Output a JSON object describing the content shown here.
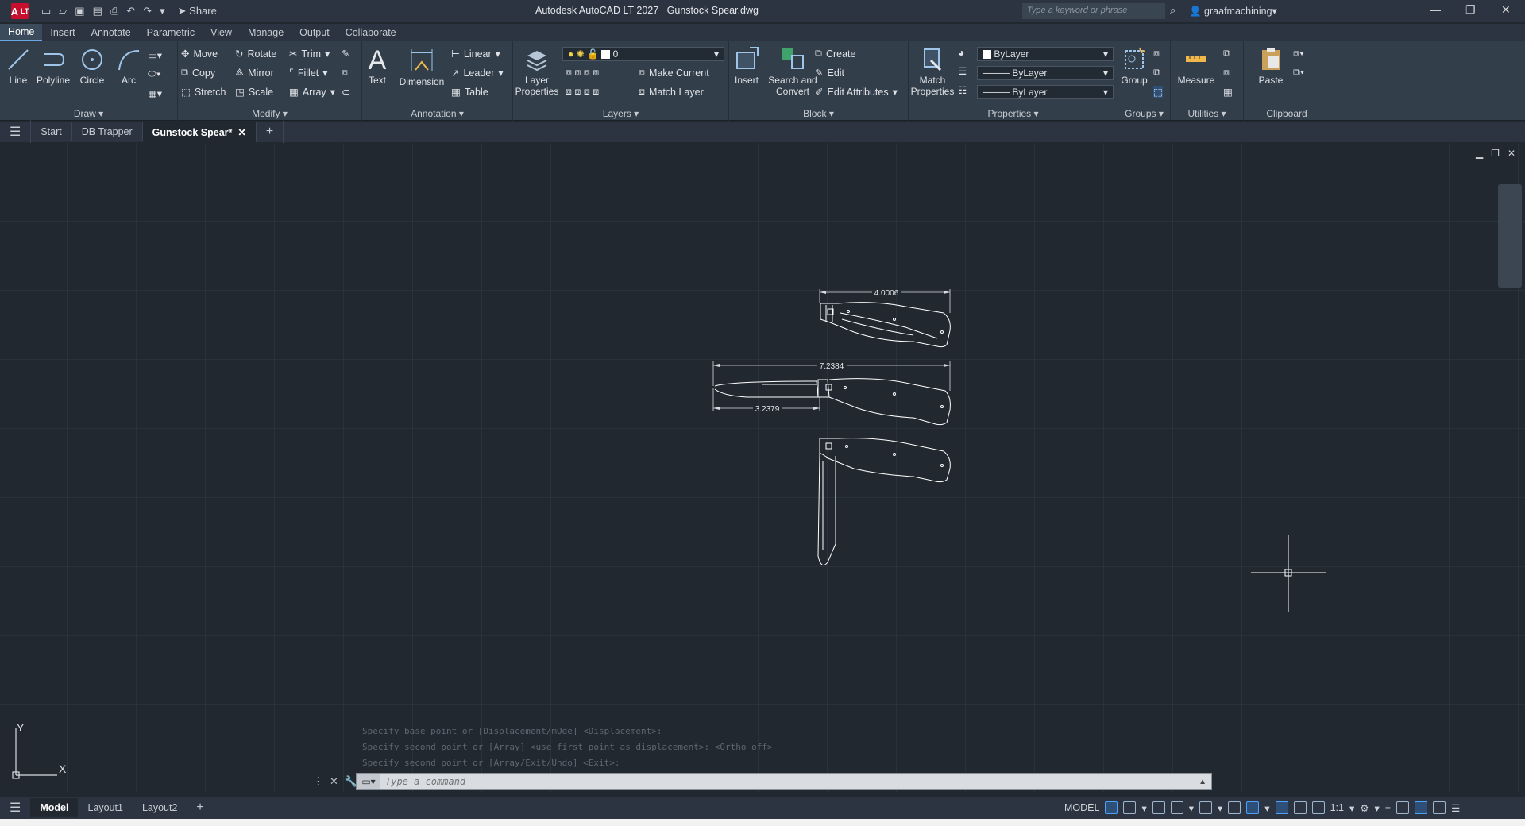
{
  "app": {
    "title": "Autodesk AutoCAD LT 2027",
    "document": "Gunstock Spear.dwg",
    "logo": "A",
    "edition": "LT",
    "share_label": "Share",
    "search_placeholder": "Type a keyword or phrase",
    "user": "graafmachining"
  },
  "menu": [
    "Home",
    "Insert",
    "Annotate",
    "Parametric",
    "View",
    "Manage",
    "Output",
    "Collaborate"
  ],
  "ribbon": {
    "draw": {
      "title": "Draw",
      "line": "Line",
      "polyline": "Polyline",
      "circle": "Circle",
      "arc": "Arc"
    },
    "modify": {
      "title": "Modify",
      "move": "Move",
      "rotate": "Rotate",
      "trim": "Trim",
      "copy": "Copy",
      "mirror": "Mirror",
      "fillet": "Fillet",
      "stretch": "Stretch",
      "scale": "Scale",
      "array": "Array"
    },
    "annotation": {
      "title": "Annotation",
      "text": "Text",
      "dimension": "Dimension",
      "linear": "Linear",
      "leader": "Leader",
      "table": "Table"
    },
    "layers": {
      "title": "Layers",
      "layer_properties_1": "Layer",
      "layer_properties_2": "Properties",
      "current_layer": "0",
      "make_current": "Make Current",
      "match_layer": "Match Layer"
    },
    "block": {
      "title": "Block",
      "insert": "Insert",
      "search_convert_1": "Search and",
      "search_convert_2": "Convert",
      "create": "Create",
      "edit": "Edit",
      "edit_attributes": "Edit Attributes"
    },
    "properties": {
      "title": "Properties",
      "match_1": "Match",
      "match_2": "Properties",
      "color": "ByLayer",
      "linetype": "ByLayer",
      "lineweight": "ByLayer"
    },
    "groups": {
      "title": "Groups",
      "group": "Group"
    },
    "utilities": {
      "title": "Utilities",
      "measure": "Measure"
    },
    "clipboard": {
      "title": "Clipboard",
      "paste": "Paste"
    }
  },
  "doc_tabs": [
    "Start",
    "DB Trapper",
    "Gunstock Spear*"
  ],
  "drawing": {
    "dim_top": "4.0006",
    "dim_overall": "7.2384",
    "dim_blade": "3.2379"
  },
  "command": {
    "history": [
      "Specify base point or [Displacement/mOde] <Displacement>:",
      "Specify second point or [Array] <use first point as displacement>:  <Ortho off>",
      "Specify second point or [Array/Exit/Undo] <Exit>:"
    ],
    "placeholder": "Type a command"
  },
  "layouts": [
    "Model",
    "Layout1",
    "Layout2"
  ],
  "status": {
    "mode": "MODEL",
    "scale": "1:1"
  },
  "colors": {
    "accent": "#6aa6e3",
    "canvas": "#212830",
    "ribbon": "#333e4b"
  }
}
